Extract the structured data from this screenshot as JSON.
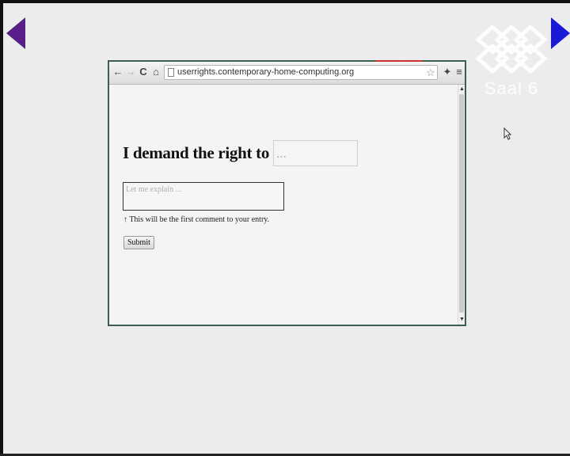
{
  "presentation": {
    "logo_text": "Saal 6",
    "prev_icon": "triangle-left-icon",
    "next_icon": "triangle-right-icon",
    "prev_color": "#5a1e8c",
    "next_color": "#1a1ad6"
  },
  "browser": {
    "url": "userrights.contemporary-home-computing.org",
    "back_icon": "←",
    "forward_icon": "→",
    "reload_icon": "C",
    "home_icon": "⌂",
    "bookmark_icon": "☆",
    "extension_icon": "✦",
    "menu_icon": "≡"
  },
  "page": {
    "heading": "I demand the right to",
    "right_placeholder": "...",
    "explain_placeholder": "Let me explain ...",
    "hint": "↑ This will be the first comment to your entry.",
    "submit_label": "Submit"
  }
}
